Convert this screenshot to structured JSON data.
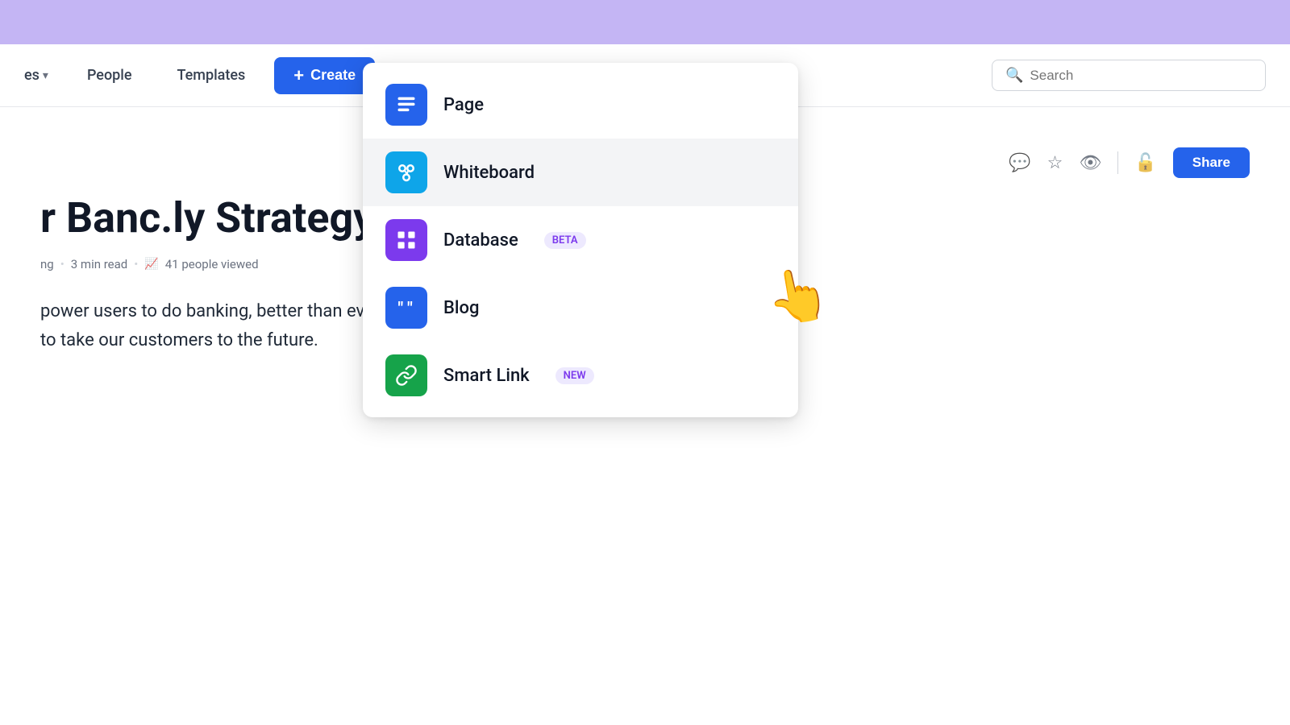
{
  "banner": {},
  "navbar": {
    "pages_label": "es",
    "chevron": "▾",
    "people_label": "People",
    "templates_label": "Templates",
    "create_label": "Create",
    "create_plus": "+",
    "search_placeholder": "Search"
  },
  "toolbar": {
    "share_label": "Share"
  },
  "page": {
    "title": "r Banc.ly Strategy",
    "meta_author": "ng",
    "meta_read": "3 min read",
    "meta_views": "41 people viewed",
    "body_line1": "power users to do banking, better than ever. We are a credit card company",
    "body_line2": "to take our customers to the future."
  },
  "dropdown": {
    "items": [
      {
        "id": "page",
        "label": "Page",
        "icon_type": "page",
        "icon_symbol": "≡",
        "badge": null
      },
      {
        "id": "whiteboard",
        "label": "Whiteboard",
        "icon_type": "whiteboard",
        "icon_symbol": "⌘",
        "badge": null
      },
      {
        "id": "database",
        "label": "Database",
        "icon_type": "database",
        "icon_symbol": "⊞",
        "badge": "BETA",
        "badge_type": "beta"
      },
      {
        "id": "blog",
        "label": "Blog",
        "icon_type": "blog",
        "icon_symbol": "❝❞",
        "badge": null
      },
      {
        "id": "smartlink",
        "label": "Smart Link",
        "icon_type": "smartlink",
        "icon_symbol": "⊕",
        "badge": "NEW",
        "badge_type": "new"
      }
    ]
  }
}
